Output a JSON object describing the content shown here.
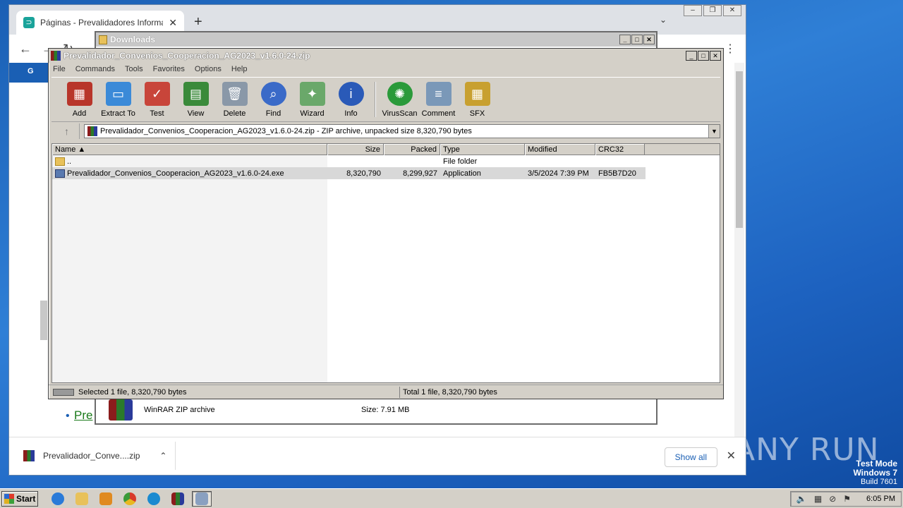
{
  "desktop": {
    "watermark_line1": "Test Mode",
    "watermark_line2": "Windows 7",
    "watermark_line3": "Build 7601",
    "brand": "ANY RUN"
  },
  "chrome": {
    "tab_title": "Páginas - Prevalidadores Informacion",
    "new_tab_icon": "plus-icon",
    "download_item": "Prevalidador_Conve....zip",
    "show_all": "Show all",
    "page_link": "Pre"
  },
  "explorer": {
    "title": "Downloads",
    "file_type": "WinRAR ZIP archive",
    "file_size": "Size: 7.91 MB"
  },
  "winrar": {
    "title": "Prevalidador_Convenios_Cooperacion_AG2023_v1.6.0-24.zip",
    "menu": [
      "File",
      "Commands",
      "Tools",
      "Favorites",
      "Options",
      "Help"
    ],
    "tools": [
      {
        "label": "Add",
        "icon": "add-archive-icon",
        "color": "#b8352a"
      },
      {
        "label": "Extract To",
        "icon": "extract-folder-icon",
        "color": "#3b8ad8"
      },
      {
        "label": "Test",
        "icon": "test-clipboard-icon",
        "color": "#c8453a"
      },
      {
        "label": "View",
        "icon": "view-book-icon",
        "color": "#3a8a3a"
      },
      {
        "label": "Delete",
        "icon": "trash-icon",
        "color": "#8a98a8"
      },
      {
        "label": "Find",
        "icon": "magnifier-icon",
        "color": "#3a6ac8"
      },
      {
        "label": "Wizard",
        "icon": "magic-wand-icon",
        "color": "#6aa86a"
      },
      {
        "label": "Info",
        "icon": "info-icon",
        "color": "#2a5ab8"
      }
    ],
    "tools2": [
      {
        "label": "VirusScan",
        "icon": "virus-scan-icon",
        "color": "#2a9a3a"
      },
      {
        "label": "Comment",
        "icon": "comment-icon",
        "color": "#7a98b8"
      },
      {
        "label": "SFX",
        "icon": "sfx-archive-icon",
        "color": "#c8a030"
      }
    ],
    "address": "Prevalidador_Convenios_Cooperacion_AG2023_v1.6.0-24.zip - ZIP archive, unpacked size 8,320,790 bytes",
    "columns": [
      "Name",
      "Size",
      "Packed",
      "Type",
      "Modified",
      "CRC32"
    ],
    "rows": [
      {
        "name": "..",
        "size": "",
        "packed": "",
        "type": "File folder",
        "modified": "",
        "crc": ""
      },
      {
        "name": "Prevalidador_Convenios_Cooperacion_AG2023_v1.6.0-24.exe",
        "size": "8,320,790",
        "packed": "8,299,927",
        "type": "Application",
        "modified": "3/5/2024 7:39 PM",
        "crc": "FB5B7D20"
      }
    ],
    "status_left": "Selected 1 file, 8,320,790 bytes",
    "status_right": "Total 1 file, 8,320,790 bytes"
  },
  "taskbar": {
    "start": "Start",
    "clock": "6:05 PM"
  }
}
